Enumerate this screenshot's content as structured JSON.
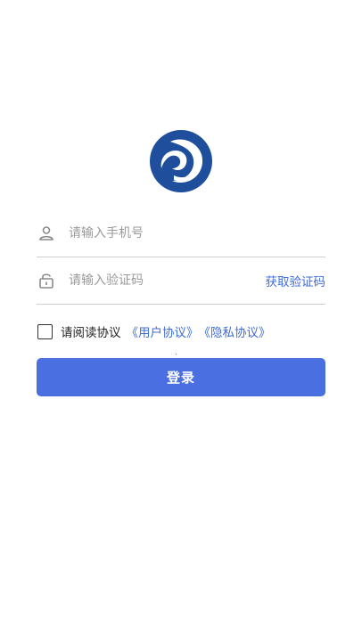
{
  "logo": {
    "icon": "brand-logo",
    "color": "#1f4e9c"
  },
  "phone_field": {
    "icon": "user-icon",
    "placeholder": "请输入手机号",
    "value": ""
  },
  "code_field": {
    "icon": "lock-icon",
    "placeholder": "请输入验证码",
    "value": "",
    "get_code_label": "获取验证码"
  },
  "agreement": {
    "checked": false,
    "prefix": "请阅读协议",
    "user_agreement": "《用户协议》",
    "privacy_policy": "《隐私协议》"
  },
  "login_button": {
    "label": "登录",
    "color": "#4a6fe0"
  },
  "colors": {
    "accent": "#3f6cd8",
    "divider": "#cfcfcf"
  }
}
